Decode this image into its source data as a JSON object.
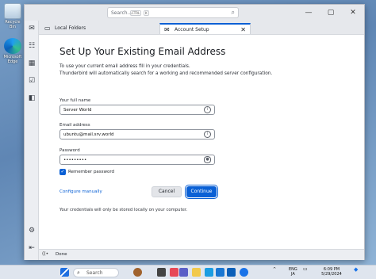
{
  "desktop": {
    "icons": [
      {
        "label": "Recycle Bin",
        "icon": "recycle-bin-icon"
      },
      {
        "label": "Microsoft Edge",
        "icon": "edge-icon"
      }
    ]
  },
  "titlebar": {
    "search_placeholder": "Search...",
    "shortcut_ctrl": "CTRL",
    "shortcut_key": "K",
    "minimize": "—",
    "maximize": "▢",
    "close": "✕"
  },
  "tabs": [
    {
      "label": "Local Folders",
      "icon": "folder-icon"
    },
    {
      "label": "Account Setup",
      "icon": "envelope-icon",
      "close": "✕"
    }
  ],
  "setup": {
    "title": "Set Up Your Existing Email Address",
    "intro_line1": "To use your current email address fill in your credentials.",
    "intro_line2": "Thunderbird will automatically search for a working and recommended server configuration.",
    "fullname_label": "Your full name",
    "fullname_value": "Server World",
    "email_label": "Email address",
    "email_value": "ubuntu@mail.srv.world",
    "password_label": "Password",
    "password_value": "•••••••••",
    "remember_label": "Remember password",
    "remember_checked": true,
    "configure_link": "Configure manually",
    "cancel_label": "Cancel",
    "continue_label": "Continue",
    "note": "Your credentials will only be stored locally on your computer.",
    "accent_color": "#0a60d5"
  },
  "status": {
    "text": "Done"
  },
  "taskbar": {
    "search_label": "Search",
    "lang1": "ENG",
    "lang2": "JA",
    "time": "6:09 PM",
    "date": "5/29/2024"
  }
}
